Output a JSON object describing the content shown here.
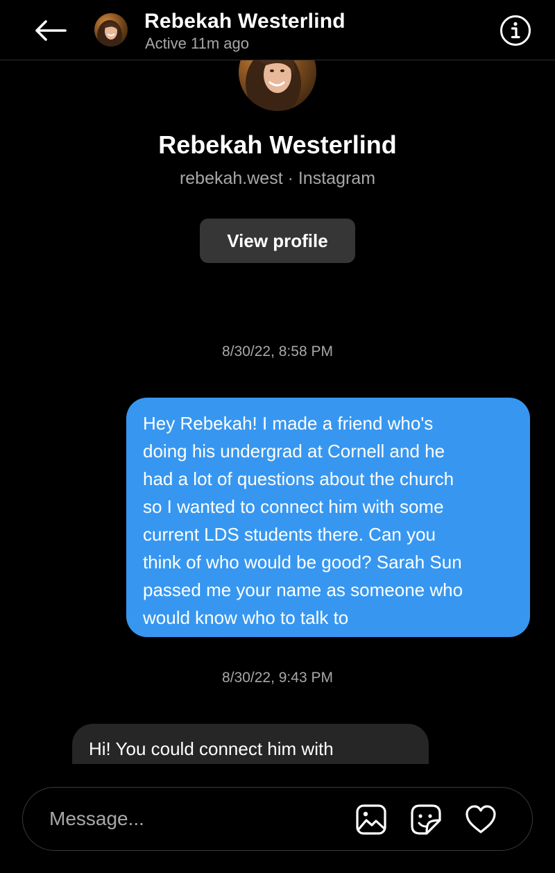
{
  "header": {
    "contact_name": "Rebekah Westerlind",
    "status": "Active 11m ago"
  },
  "profile": {
    "name": "Rebekah Westerlind",
    "subtitle": "rebekah.west · Instagram",
    "view_profile_label": "View profile"
  },
  "conversation": {
    "timestamp_1": "8/30/22, 8:58 PM",
    "sent_message_lines": [
      "Hey Rebekah! I made a friend who's",
      "doing his undergrad at Cornell and he",
      "had a lot of questions about the church",
      "so I wanted to connect him with some",
      "current LDS students there. Can you",
      "think of who would be good? Sarah Sun",
      "passed me your name as someone who",
      "would know who to talk to"
    ],
    "timestamp_2": "8/30/22, 9:43 PM",
    "received_message_partial": "Hi! You could connect him with"
  },
  "composer": {
    "placeholder": "Message..."
  },
  "icons": {
    "back": "arrow-left-icon",
    "info": "info-icon",
    "gallery": "image-icon",
    "sticker": "sticker-icon",
    "like": "heart-icon"
  },
  "colors": {
    "background": "#000000",
    "sent_bubble": "#3797f0",
    "received_bubble": "#262626",
    "button": "#363636",
    "secondary_text": "#a8a8a8"
  }
}
